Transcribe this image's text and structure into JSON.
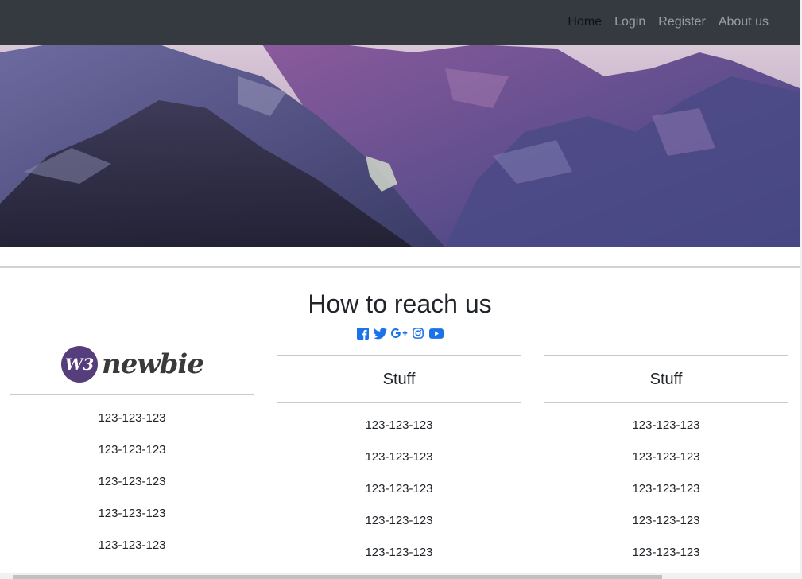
{
  "navbar": {
    "links": [
      {
        "label": "Home",
        "active": true
      },
      {
        "label": "Login",
        "active": false
      },
      {
        "label": "Register",
        "active": false
      },
      {
        "label": "About us",
        "active": false
      }
    ]
  },
  "hero": {
    "image": "purple-mountain-landscape"
  },
  "contact": {
    "title": "How to reach us",
    "social_icons": [
      "facebook-icon",
      "twitter-icon",
      "google-plus-icon",
      "instagram-icon",
      "youtube-icon"
    ],
    "social_color": "#1a73e8"
  },
  "columns": [
    {
      "logo_mark": "W3",
      "logo_text": "newbie",
      "logo_color": "#563d7c",
      "phones": [
        "123-123-123",
        "123-123-123",
        "123-123-123",
        "123-123-123",
        "123-123-123"
      ]
    },
    {
      "title": "Stuff",
      "phones": [
        "123-123-123",
        "123-123-123",
        "123-123-123",
        "123-123-123",
        "123-123-123"
      ]
    },
    {
      "title": "Stuff",
      "phones": [
        "123-123-123",
        "123-123-123",
        "123-123-123",
        "123-123-123",
        "123-123-123"
      ]
    }
  ]
}
